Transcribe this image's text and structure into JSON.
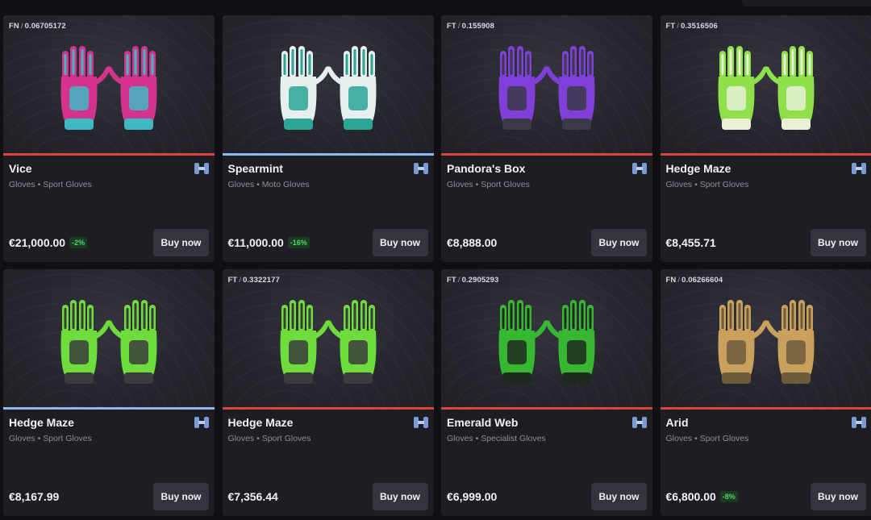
{
  "ui": {
    "buy_label": "Buy now"
  },
  "colors": {
    "covert": "#e0433e",
    "blue": "#8fb8f0",
    "discount": "#4fd46a"
  },
  "items": [
    {
      "wear": "FN",
      "float": "0.06705172",
      "name": "Vice",
      "category": "Gloves • Sport Gloves",
      "price": "€21,000.00",
      "discount": "-2%",
      "rarity": "covert",
      "icon": "sport-gloves-vice-image",
      "palette": [
        "#d4338d",
        "#3fb8c4"
      ]
    },
    {
      "wear": "",
      "float": "",
      "name": "Spearmint",
      "category": "Gloves • Moto Gloves",
      "price": "€11,000.00",
      "discount": "-16%",
      "rarity": "blue",
      "icon": "moto-gloves-spearmint-image",
      "palette": [
        "#e6eeee",
        "#2aa596"
      ]
    },
    {
      "wear": "FT",
      "float": "0.155908",
      "name": "Pandora's Box",
      "category": "Gloves • Sport Gloves",
      "price": "€8,888.00",
      "discount": "",
      "rarity": "covert",
      "icon": "sport-gloves-pandoras-box-image",
      "palette": [
        "#7f3fd8",
        "#3a3a48"
      ]
    },
    {
      "wear": "FT",
      "float": "0.3516506",
      "name": "Hedge Maze",
      "category": "Gloves • Sport Gloves",
      "price": "€8,455.71",
      "discount": "",
      "rarity": "covert",
      "icon": "sport-gloves-hedge-maze-image",
      "palette": [
        "#8fe04a",
        "#e8f0d8"
      ]
    },
    {
      "wear": "",
      "float": "",
      "name": "Hedge Maze",
      "category": "Gloves • Sport Gloves",
      "price": "€8,167.99",
      "discount": "",
      "rarity": "blue",
      "icon": "sport-gloves-hedge-maze-image",
      "palette": [
        "#6fdc3e",
        "#3c3c3c"
      ]
    },
    {
      "wear": "FT",
      "float": "0.3322177",
      "name": "Hedge Maze",
      "category": "Gloves • Sport Gloves",
      "price": "€7,356.44",
      "discount": "",
      "rarity": "covert",
      "icon": "sport-gloves-hedge-maze-image",
      "palette": [
        "#6fdc3e",
        "#3c3c3c"
      ]
    },
    {
      "wear": "FT",
      "float": "0.2905293",
      "name": "Emerald Web",
      "category": "Gloves • Specialist Gloves",
      "price": "€6,999.00",
      "discount": "",
      "rarity": "covert",
      "icon": "specialist-gloves-emerald-web-image",
      "palette": [
        "#38b832",
        "#1e2a1e"
      ]
    },
    {
      "wear": "FN",
      "float": "0.06266604",
      "name": "Arid",
      "category": "Gloves • Sport Gloves",
      "price": "€6,800.00",
      "discount": "-8%",
      "rarity": "covert",
      "icon": "sport-gloves-arid-image",
      "palette": [
        "#c9a15c",
        "#6e5a3c"
      ]
    }
  ]
}
